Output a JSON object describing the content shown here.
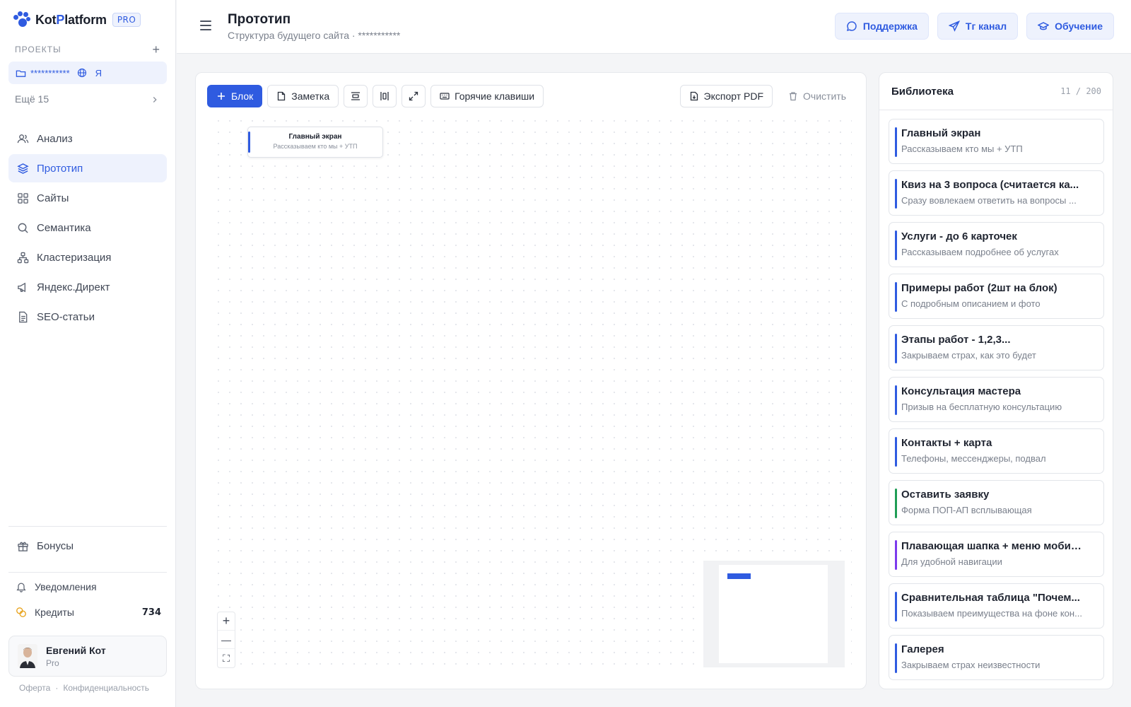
{
  "app": {
    "logo_plain_1": "Kot",
    "logo_accent": "P",
    "logo_plain_2": "latform",
    "badge": "PRO"
  },
  "sidebar": {
    "projects_label": "ПРОЕКТЫ",
    "add_label": "+",
    "current_project": "***********",
    "project_tag": "Я",
    "more_label": "Ещё 15",
    "nav": [
      {
        "label": "Анализ",
        "icon": "users-icon",
        "active": false
      },
      {
        "label": "Прототип",
        "icon": "layers-icon",
        "active": true
      },
      {
        "label": "Сайты",
        "icon": "grid-icon",
        "active": false
      },
      {
        "label": "Семантика",
        "icon": "search-icon",
        "active": false
      },
      {
        "label": "Кластеризация",
        "icon": "cluster-icon",
        "active": false
      },
      {
        "label": "Яндекс.Директ",
        "icon": "megaphone-icon",
        "active": false
      },
      {
        "label": "SEO-статьи",
        "icon": "document-icon",
        "active": false
      }
    ],
    "bonus_label": "Бонусы",
    "notifications_label": "Уведомления",
    "credits_label": "Кредиты",
    "credits_value": "734",
    "user_name": "Евгений Кот",
    "user_plan": "Pro",
    "legal_offer": "Оферта",
    "legal_dot": "·",
    "legal_privacy": "Конфиденциальность"
  },
  "header": {
    "title": "Прототип",
    "subtitle": "Структура будущего сайта · ***********",
    "buttons": {
      "support": "Поддержка",
      "tg": "Tг канал",
      "learning": "Обучение"
    }
  },
  "toolbar": {
    "block": "Блок",
    "note": "Заметка",
    "hotkeys": "Горячие клавиши",
    "export": "Экспорт PDF",
    "clear": "Очистить"
  },
  "canvas": {
    "node_title": "Главный экран",
    "node_subtitle": "Рассказываем кто мы + УТП",
    "zoom_in": "+",
    "zoom_out": "—",
    "fit": "⛶"
  },
  "library": {
    "title": "Библиотека",
    "count": "11 / 200",
    "items": [
      {
        "title": "Главный экран",
        "subtitle": "Рассказываем кто мы + УТП",
        "color": "#2f5be0"
      },
      {
        "title": "Квиз на 3 вопроса (считается ка...",
        "subtitle": "Сразу вовлекаем ответить на вопросы ...",
        "color": "#2f5be0"
      },
      {
        "title": "Услуги - до 6 карточек",
        "subtitle": "Рассказываем подробнее об услугах",
        "color": "#2f5be0"
      },
      {
        "title": "Примеры работ (2шт на блок)",
        "subtitle": "С подробным описанием и фото",
        "color": "#2f5be0"
      },
      {
        "title": "Этапы работ - 1,2,3...",
        "subtitle": "Закрываем страх, как это будет",
        "color": "#2f5be0"
      },
      {
        "title": "Консультация мастера",
        "subtitle": "Призыв на бесплатную консультацию",
        "color": "#2f5be0"
      },
      {
        "title": "Контакты + карта",
        "subtitle": "Телефоны, мессенджеры, подвал",
        "color": "#2f5be0"
      },
      {
        "title": "Оставить заявку",
        "subtitle": "Форма ПОП-АП всплывающая",
        "color": "#1f9d55"
      },
      {
        "title": "Плавающая шапка + меню мобил...",
        "subtitle": "Для удобной навигации",
        "color": "#7c3aed"
      },
      {
        "title": "Сравнительная таблица \"Почем...",
        "subtitle": "Показываем преимущества на фоне кон...",
        "color": "#2f5be0"
      },
      {
        "title": "Галерея",
        "subtitle": "Закрываем страх неизвестности",
        "color": "#2f5be0"
      }
    ]
  }
}
